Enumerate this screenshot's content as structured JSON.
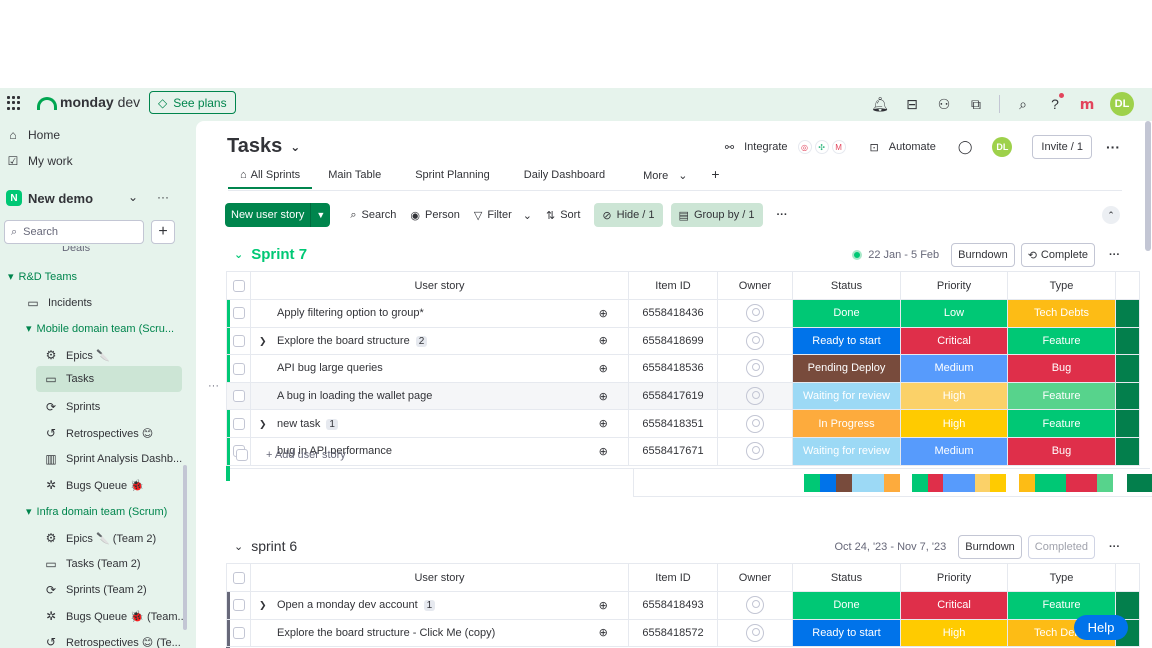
{
  "topbar": {
    "logo_bold": "monday",
    "logo_rest": " dev",
    "see_plans": "See plans",
    "avatar": "DL"
  },
  "sidebar": {
    "home": "Home",
    "my_work": "My work",
    "workspace_badge": "N",
    "workspace": "New demo",
    "search_placeholder": "Search",
    "partial_item": "Deals",
    "rd_teams": "R&D Teams",
    "incidents": "Incidents",
    "mobile_team": "Mobile domain team (Scru...",
    "epics": "Epics 🔪",
    "tasks": "Tasks",
    "sprints": "Sprints",
    "retrospectives": "Retrospectives 😊",
    "sprint_analysis": "Sprint Analysis Dashb...",
    "bugs_queue": "Bugs Queue 🐞",
    "infra_team": "Infra domain team (Scrum)",
    "epics2": "Epics 🔪 (Team 2)",
    "tasks2": "Tasks (Team 2)",
    "sprints2": "Sprints (Team 2)",
    "bugs_queue2": "Bugs Queue 🐞 (Team...",
    "retro2": "Retrospectives 😊 (Te..."
  },
  "board": {
    "title": "Tasks",
    "integrate": "Integrate",
    "automate": "Automate",
    "avatar": "DL",
    "invite": "Invite / 1",
    "tabs": [
      "All Sprints",
      "Main Table",
      "Sprint Planning",
      "Daily Dashboard",
      "More"
    ],
    "toolbar": {
      "new_item": "New user story",
      "search": "Search",
      "person": "Person",
      "filter": "Filter",
      "sort": "Sort",
      "hide": "Hide / 1",
      "group_by": "Group by / 1"
    }
  },
  "columns": [
    "User story",
    "Item ID",
    "Owner",
    "Status",
    "Priority",
    "Type"
  ],
  "colors": {
    "done": "#00c875",
    "ready": "#0073ea",
    "pending": "#784b3c",
    "waiting": "#9cd9f5",
    "progress": "#fdab3d",
    "critical": "#df2f4a",
    "medium": "#579bfc",
    "low": "#00c875",
    "high": "#ffcb00",
    "high_light": "#fbd168",
    "feature": "#00c875",
    "feature_light": "#57d38c",
    "bug": "#df2f4a",
    "tech": "#fdbc15",
    "dark_green": "#037f4c"
  },
  "sprint7": {
    "name": "Sprint 7",
    "dates": "22 Jan - 5 Feb",
    "burndown": "Burndown",
    "complete": "Complete",
    "add": "+ Add user story",
    "rows": [
      {
        "story": "Apply filtering option to group*",
        "expand": false,
        "sub": "",
        "id": "6558418436",
        "status": "Done",
        "status_c": "done",
        "priority": "Low",
        "priority_c": "low",
        "type": "Tech Debts",
        "type_c": "tech"
      },
      {
        "story": "Explore the board structure",
        "expand": true,
        "sub": "2",
        "id": "6558418699",
        "status": "Ready to start",
        "status_c": "ready",
        "priority": "Critical",
        "priority_c": "critical",
        "type": "Feature",
        "type_c": "feature"
      },
      {
        "story": "API bug large queries",
        "expand": false,
        "sub": "",
        "id": "6558418536",
        "status": "Pending Deploy",
        "status_c": "pending",
        "priority": "Medium",
        "priority_c": "medium",
        "type": "Bug",
        "type_c": "bug"
      },
      {
        "story": "A bug in loading the wallet page",
        "expand": false,
        "sub": "",
        "id": "6558417619",
        "status": "Waiting for review",
        "status_c": "waiting",
        "priority": "High",
        "priority_c": "high_light",
        "type": "Feature",
        "type_c": "feature_light"
      },
      {
        "story": "new task",
        "expand": true,
        "sub": "1",
        "id": "6558418351",
        "status": "In Progress",
        "status_c": "progress",
        "priority": "High",
        "priority_c": "high",
        "type": "Feature",
        "type_c": "feature"
      },
      {
        "story": "bug in API performance",
        "expand": false,
        "sub": "",
        "id": "6558417671",
        "status": "Waiting for review",
        "status_c": "waiting",
        "priority": "Medium",
        "priority_c": "medium",
        "type": "Bug",
        "type_c": "bug"
      }
    ]
  },
  "sprint6": {
    "name": "sprint 6",
    "dates": "Oct 24, '23 - Nov 7, '23",
    "burndown": "Burndown",
    "completed": "Completed",
    "rows": [
      {
        "story": "Open a monday dev account",
        "expand": true,
        "sub": "1",
        "id": "6558418493",
        "status": "Done",
        "status_c": "done",
        "priority": "Critical",
        "priority_c": "critical",
        "type": "Feature",
        "type_c": "feature"
      },
      {
        "story": "Explore the board structure - Click Me (copy)",
        "expand": false,
        "sub": "",
        "id": "6558418572",
        "status": "Ready to start",
        "status_c": "ready",
        "priority": "High",
        "priority_c": "high",
        "type": "Tech Debts",
        "type_c": "tech"
      }
    ]
  },
  "help": "Help"
}
